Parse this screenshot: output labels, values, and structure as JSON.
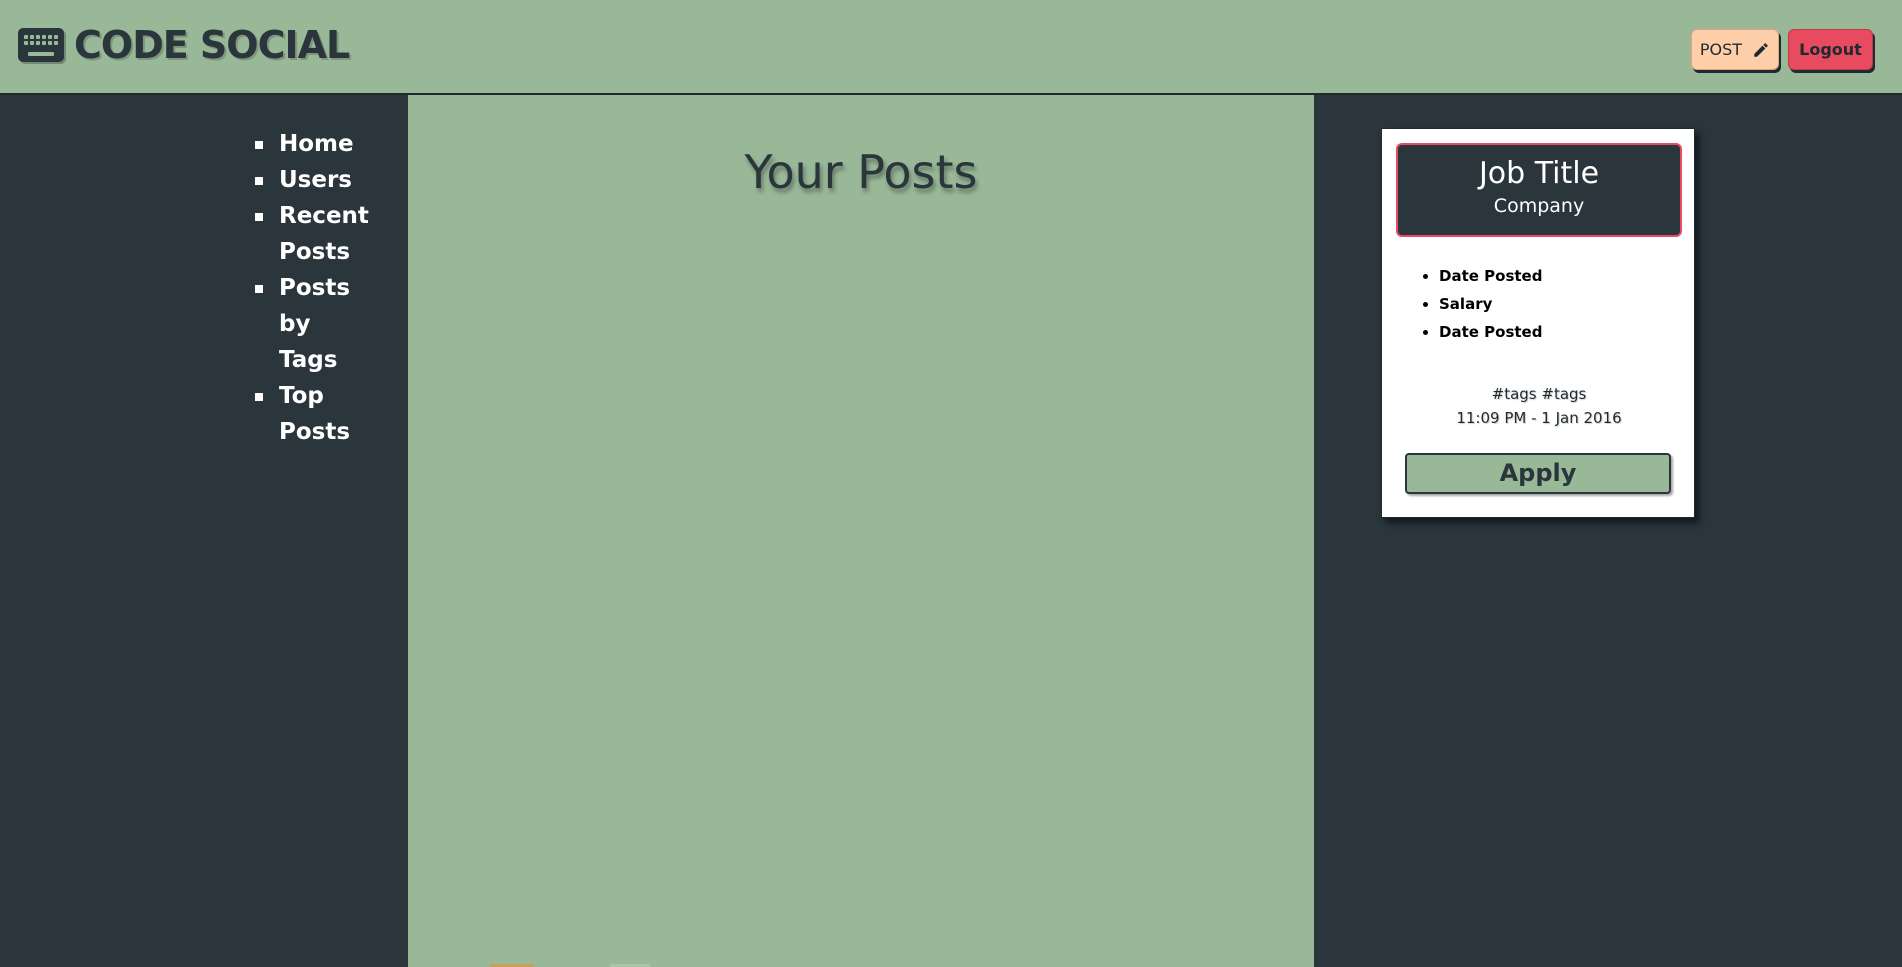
{
  "header": {
    "brand_title": "CODE SOCIAL",
    "brand_icon": "keyboard-icon",
    "post_label": "POST",
    "post_icon": "pencil-icon",
    "logout_label": "Logout"
  },
  "nav": {
    "items": [
      {
        "label": "Home"
      },
      {
        "label": "Users"
      },
      {
        "label": "Recent Posts"
      },
      {
        "label": "Posts by Tags"
      },
      {
        "label": "Top Posts"
      }
    ]
  },
  "main": {
    "title": "Your Posts"
  },
  "job_card": {
    "title": "Job Title",
    "company": "Company",
    "details": [
      "Date Posted",
      "Salary",
      "Date Posted"
    ],
    "tags": "#tags #tags",
    "timestamp": "11:09 PM - 1 Jan 2016",
    "apply_label": "Apply"
  },
  "colors": {
    "sage": "#99b898",
    "charcoal": "#2a353c",
    "peach": "#fecea8",
    "coral": "#e84a5f"
  }
}
